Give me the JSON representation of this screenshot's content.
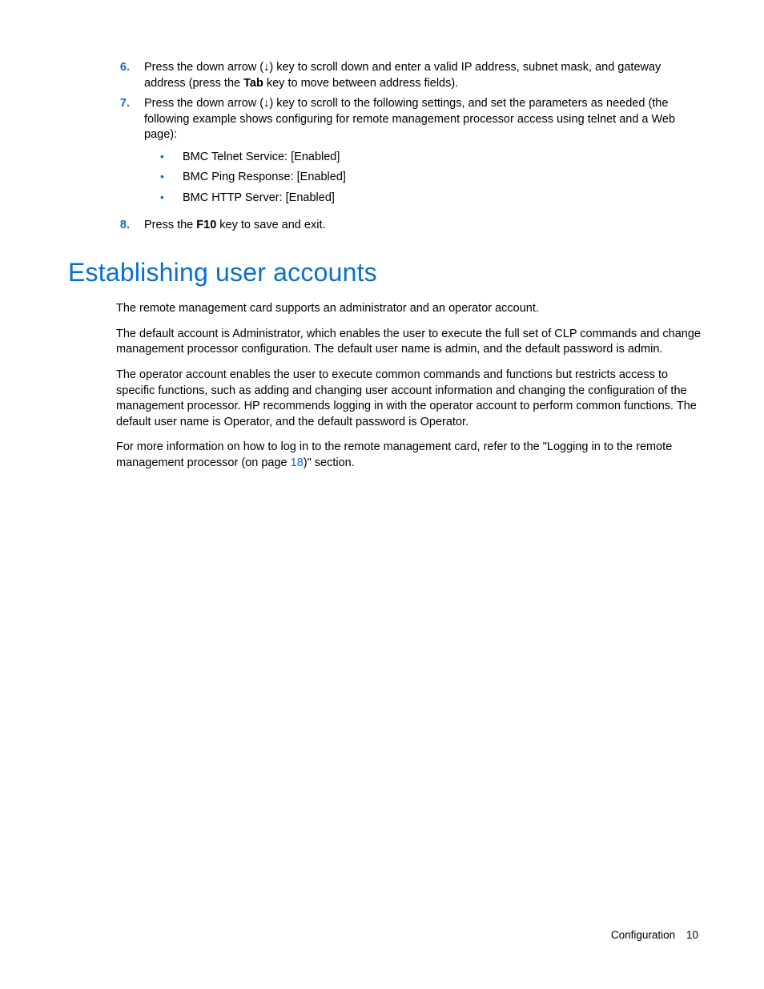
{
  "steps": {
    "s6": {
      "num": "6.",
      "pre": "Press the down arrow (↓) key to scroll down and enter a valid IP address, subnet mask, and gateway address (press the ",
      "bold": "Tab",
      "post": " key to move between address fields)."
    },
    "s7": {
      "num": "7.",
      "text": "Press the down arrow (↓) key to scroll to the following settings, and set the parameters as needed (the following example shows configuring for remote management processor access using telnet and a Web page):",
      "bullets": [
        "BMC Telnet Service: [Enabled]",
        "BMC Ping Response: [Enabled]",
        "BMC HTTP Server: [Enabled]"
      ]
    },
    "s8": {
      "num": "8.",
      "pre": "Press the ",
      "bold": "F10",
      "post": " key to save and exit."
    }
  },
  "heading": "Establishing user accounts",
  "paras": {
    "p1": "The remote management card supports an administrator and an operator account.",
    "p2": "The default account is Administrator, which enables the user to execute the full set of CLP commands and change management processor configuration. The default user name is admin, and the default password is admin.",
    "p3": "The operator account enables the user to execute common commands and functions but restricts access to specific functions, such as adding and changing user account information and changing the configuration of the management processor. HP recommends logging in with the operator account to perform common functions. The default user name is Operator, and the default password is Operator.",
    "p4_pre": "For more information on how to log in to the remote management card, refer to the \"Logging in to the remote management processor (on page ",
    "p4_link": "18",
    "p4_post": ")\" section."
  },
  "footer": {
    "section": "Configuration",
    "page": "10"
  }
}
